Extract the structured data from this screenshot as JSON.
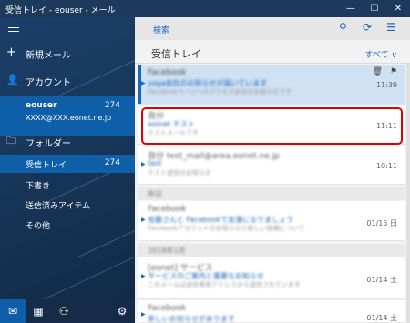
{
  "window": {
    "title": "受信トレイ - eouser - メール",
    "minimize": "—",
    "maximize": "☐",
    "close": "✕"
  },
  "sidebar": {
    "new_mail": "新規メール",
    "accounts_label": "アカウント",
    "account": {
      "name": "eouser",
      "email": "XXXX@XXX.eonet.ne.jp",
      "count": "274"
    },
    "folders_label": "フォルダー",
    "folders": [
      {
        "label": "受信トレイ",
        "count": "274"
      },
      {
        "label": "下書き",
        "count": ""
      },
      {
        "label": "送信済みアイテム",
        "count": ""
      },
      {
        "label": "その他",
        "count": ""
      }
    ]
  },
  "bottom_bar": [
    "mail-icon",
    "calendar-icon",
    "people-icon",
    "settings-icon"
  ],
  "toolbar": {
    "search": "検索"
  },
  "folder_header": {
    "title": "受信トレイ",
    "filter": "すべて ∨"
  },
  "messages": [
    {
      "sender": "Facebook",
      "subject": "yoga会社のお知らせが届いています",
      "preview": "Facebookページへのアクセス状況のお知らせです",
      "time": "11:39",
      "selected": true
    },
    {
      "sender": "自分",
      "subject": "eoinet テスト",
      "preview": "テストメールです",
      "time": "11:11",
      "selected": false
    },
    {
      "sender": "自分 test_mail@area.eonet.ne.jp",
      "subject": "test",
      "preview": "テスト送信のお知らせ",
      "time": "10:11",
      "selected": false
    }
  ],
  "groups": [
    {
      "label": "昨日"
    },
    {
      "label": "2018年1月"
    }
  ],
  "older_messages": [
    {
      "sender": "Facebook",
      "subject": "佐藤さんと Facebookで友達になりましょう",
      "preview": "Facebookアカウントのお知らせと新しい投稿について",
      "time": "01/15 日"
    },
    {
      "sender": "[eonet] サービス",
      "subject": "サービスのご案内と重要なお知らせ",
      "preview": "このメールは送信専用アドレスから送信されています",
      "time": "01/14 土"
    },
    {
      "sender": "Facebook",
      "subject": "新しいお知らせがあります",
      "preview": "",
      "time": "01/14 土"
    }
  ]
}
